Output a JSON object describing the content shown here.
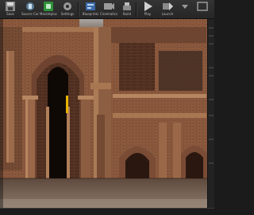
{
  "toolbar": {
    "buttons": [
      {
        "label": "Save",
        "icon": "save-icon"
      },
      {
        "label": "Source Control",
        "icon": "source-control-icon"
      },
      {
        "label": "Marketplace",
        "icon": "marketplace-icon"
      },
      {
        "label": "Settings",
        "icon": "settings-icon"
      },
      {
        "label": "Blueprints",
        "icon": "blueprints-icon"
      },
      {
        "label": "Cinematics",
        "icon": "cinematics-icon"
      },
      {
        "label": "Build",
        "icon": "build-icon"
      },
      {
        "label": "Play",
        "icon": "play-icon"
      },
      {
        "label": "Launch",
        "icon": "launch-icon"
      }
    ]
  },
  "viewport": {
    "scene": "ornate-brick-arches",
    "colors": {
      "brick": "#8a5a3e",
      "shadow": "#2a1a12",
      "highlight": "#c99a72",
      "accent": "#e7b400"
    }
  },
  "status": {
    "text": ""
  }
}
